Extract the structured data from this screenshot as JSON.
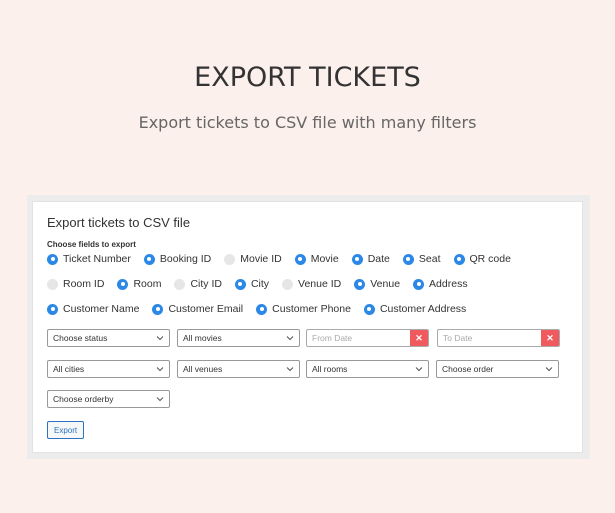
{
  "hero": {
    "title": "EXPORT TICKETS",
    "subtitle": "Export tickets to CSV file with many filters"
  },
  "panel": {
    "title": "Export tickets to CSV file",
    "fields_label": "Choose fields to export",
    "rows": [
      [
        {
          "label": "Ticket Number",
          "checked": true
        },
        {
          "label": "Booking ID",
          "checked": true
        },
        {
          "label": "Movie ID",
          "checked": false
        },
        {
          "label": "Movie",
          "checked": true
        },
        {
          "label": "Date",
          "checked": true
        },
        {
          "label": "Seat",
          "checked": true
        },
        {
          "label": "QR code",
          "checked": true
        }
      ],
      [
        {
          "label": "Room ID",
          "checked": false
        },
        {
          "label": "Room",
          "checked": true
        },
        {
          "label": "City ID",
          "checked": false
        },
        {
          "label": "City",
          "checked": true
        },
        {
          "label": "Venue ID",
          "checked": false
        },
        {
          "label": "Venue",
          "checked": true
        },
        {
          "label": "Address",
          "checked": true
        }
      ],
      [
        {
          "label": "Customer Name",
          "checked": true
        },
        {
          "label": "Customer Email",
          "checked": true
        },
        {
          "label": "Customer Phone",
          "checked": true
        },
        {
          "label": "Customer Address",
          "checked": true
        }
      ]
    ],
    "filters": {
      "status": "Choose status",
      "movies": "All movies",
      "from_date_placeholder": "From Date",
      "to_date_placeholder": "To Date",
      "clear_glyph": "✕",
      "cities": "All cities",
      "venues": "All venues",
      "rooms": "All rooms",
      "order": "Choose order",
      "orderby": "Choose orderby"
    },
    "export_label": "Export"
  },
  "colors": {
    "accent": "#2b88e6",
    "clear_button": "#f0595d",
    "background": "#fbf0eb"
  }
}
